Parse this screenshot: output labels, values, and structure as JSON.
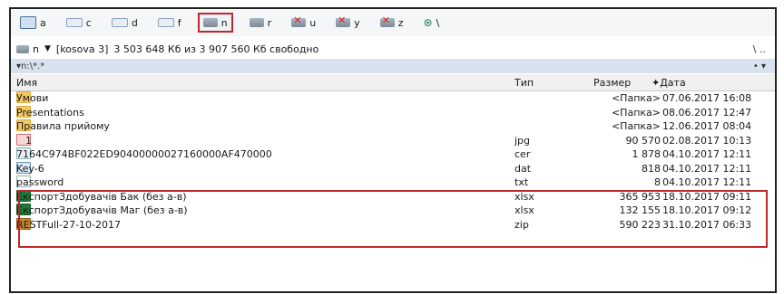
{
  "toolbar": {
    "drives": [
      {
        "label": "a",
        "icon": "floppy-disk-icon",
        "active": false
      },
      {
        "label": "c",
        "icon": "hard-drive-icon",
        "active": false
      },
      {
        "label": "d",
        "icon": "hard-drive-icon",
        "active": false
      },
      {
        "label": "f",
        "icon": "removable-drive-icon",
        "active": false
      },
      {
        "label": "n",
        "icon": "network-drive-icon",
        "active": true
      },
      {
        "label": "r",
        "icon": "network-drive-icon",
        "active": false
      },
      {
        "label": "u",
        "icon": "disconnected-network-drive-icon",
        "active": false
      },
      {
        "label": "y",
        "icon": "disconnected-network-drive-icon",
        "active": false
      },
      {
        "label": "z",
        "icon": "disconnected-network-drive-icon",
        "active": false
      },
      {
        "label": "\\",
        "icon": "network-globe-icon",
        "active": false
      }
    ]
  },
  "pathbar": {
    "drive": "n",
    "volume": "[kosova 3]",
    "free_space": "3 503 648 Кб из 3 907 560 Кб свободно",
    "right": "\\   .."
  },
  "filter": {
    "text": "▾n:\\*.*",
    "right": "•  ▾"
  },
  "columns": {
    "name": "Имя",
    "type": "Тип",
    "size": "Размер",
    "date": "✦Дата"
  },
  "files": [
    {
      "name": "Умови",
      "type": "",
      "size": "<Папка>",
      "date": "07.06.2017 16:08",
      "kind": "folder"
    },
    {
      "name": "Presentations",
      "type": "",
      "size": "<Папка>",
      "date": "08.06.2017 12:47",
      "kind": "folder"
    },
    {
      "name": "Правила прийому",
      "type": "",
      "size": "<Папка>",
      "date": "12.06.2017 08:04",
      "kind": "folder"
    },
    {
      "name": "1",
      "type": "jpg",
      "size": "90 570",
      "date": "02.08.2017 10:13",
      "kind": "img"
    },
    {
      "name": "7164C974BF022ED90400000027160000AF470000",
      "type": "cer",
      "size": "1 878",
      "date": "04.10.2017 12:11",
      "kind": "cer"
    },
    {
      "name": "Key-6",
      "type": "dat",
      "size": "818",
      "date": "04.10.2017 12:11",
      "kind": "dat"
    },
    {
      "name": "password",
      "type": "txt",
      "size": "8",
      "date": "04.10.2017 12:11",
      "kind": "txt"
    },
    {
      "name": "ЕкспортЗдобувачів Бак (без а-в)",
      "type": "xlsx",
      "size": "365 953",
      "date": "18.10.2017 09:11",
      "kind": "xls"
    },
    {
      "name": "ЕкспортЗдобувачів Маг (без а-в)",
      "type": "xlsx",
      "size": "132 155",
      "date": "18.10.2017 09:12",
      "kind": "xls"
    },
    {
      "name": "RESTFull-27-10-2017",
      "type": "zip",
      "size": "590 223",
      "date": "31.10.2017 06:33",
      "kind": "zip"
    }
  ],
  "colors": {
    "highlight": "#c0262b",
    "filter_bar": "#d7e2ee",
    "folder": "#f4c95d"
  }
}
